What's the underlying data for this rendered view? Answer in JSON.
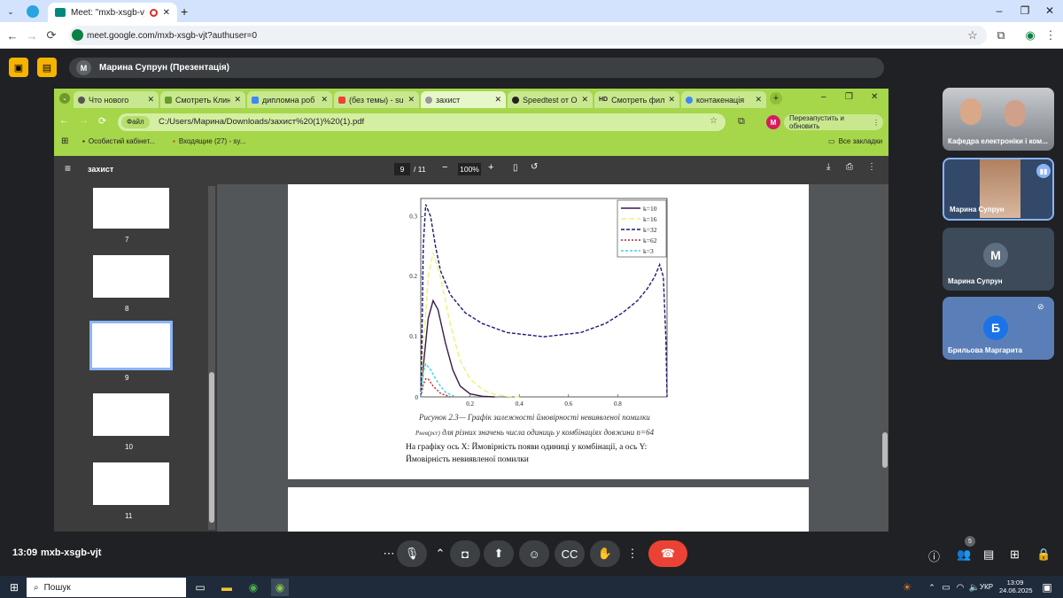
{
  "chrome": {
    "tab_title": "Meet: \"mxb-xsgb-vjt\"",
    "url": "meet.google.com/mxb-xsgb-vjt?authuser=0"
  },
  "meet": {
    "presenter_label": "Марина Супрун (Презентація)",
    "time": "13:09",
    "meeting_code": "mxb-xsgb-vjt",
    "participants_badge": "5",
    "participants": [
      {
        "name": "Кафедра електроніки і ком..."
      },
      {
        "name": "Марина Супрун"
      },
      {
        "name": "Марина Супрун",
        "initial": "М"
      },
      {
        "name": "Брильова Маргарита",
        "initial": "Б"
      }
    ],
    "presenter_avatar": "М"
  },
  "inner": {
    "tabs": [
      {
        "label": "Что нового"
      },
      {
        "label": "Смотреть Клин"
      },
      {
        "label": "дипломна роб"
      },
      {
        "label": "(без темы) - sur"
      },
      {
        "label": "захист"
      },
      {
        "label": "Speedtest от Ос"
      },
      {
        "label": "Смотреть филь"
      },
      {
        "label": "контакенація"
      }
    ],
    "file_chip": "Файл",
    "path": "C:/Users/Марина/Downloads/захист%20(1)%20(1).pdf",
    "relaunch": "Перезапустить и обновить",
    "profile": "М",
    "bookmarks": [
      {
        "label": "Особистий кабінет..."
      },
      {
        "label": "Входящие (27) - sy..."
      }
    ],
    "all_bookmarks": "Все закладки"
  },
  "pdf": {
    "title": "захист",
    "page_current": "9",
    "page_total": "/ 11",
    "zoom": "100%",
    "thumbs": [
      "7",
      "8",
      "9",
      "10",
      "11"
    ],
    "caption_line1": "Рисунок 2.3— Графік залежності ймовірності невиявленої помилки",
    "caption_line2_sym": "Pнев(pcr)",
    "caption_line2": "для різних значень числа одиниць у комбінаціях довжини  n=64",
    "body_line1": "На графіку ось X: Ймовірність появи одиниці у комбінації, а ось Y:",
    "body_line2": "Ймовірність невиявленої помилки"
  },
  "chart_data": {
    "type": "line",
    "xlim": [
      0,
      1
    ],
    "ylim": [
      0,
      0.33
    ],
    "x_ticks": [
      "0.2",
      "0.4",
      "0.6",
      "0.8"
    ],
    "y_ticks": [
      "0.1",
      "0.2",
      "0.3"
    ],
    "origin_label": "0",
    "legend": "top-right",
    "series": [
      {
        "name": "k=10",
        "color": "#3b1a4a",
        "dash": "solid",
        "x": [
          0,
          0.01,
          0.03,
          0.05,
          0.07,
          0.1,
          0.13,
          0.16,
          0.2,
          0.25,
          0.3
        ],
        "y": [
          0,
          0.05,
          0.13,
          0.16,
          0.145,
          0.09,
          0.045,
          0.018,
          0.005,
          0.001,
          0
        ]
      },
      {
        "name": "k=16",
        "color": "#f0f07a",
        "dash": "6,3",
        "x": [
          0,
          0.01,
          0.03,
          0.05,
          0.08,
          0.12,
          0.16,
          0.2,
          0.25,
          0.3,
          0.35,
          0.4
        ],
        "y": [
          0,
          0.08,
          0.2,
          0.24,
          0.2,
          0.12,
          0.06,
          0.03,
          0.012,
          0.004,
          0.001,
          0
        ]
      },
      {
        "name": "k=32",
        "color": "#1a1a7a",
        "dash": "4,2",
        "x": [
          0,
          0.005,
          0.01,
          0.02,
          0.04,
          0.06,
          0.08,
          0.12,
          0.18,
          0.25,
          0.35,
          0.5,
          0.65,
          0.75,
          0.82,
          0.88,
          0.92,
          0.95,
          0.97,
          0.985,
          0.995,
          1
        ],
        "y": [
          0,
          0.1,
          0.25,
          0.32,
          0.3,
          0.25,
          0.21,
          0.17,
          0.14,
          0.122,
          0.107,
          0.1,
          0.107,
          0.122,
          0.14,
          0.16,
          0.18,
          0.2,
          0.22,
          0.2,
          0.1,
          0
        ]
      },
      {
        "name": "k=62",
        "color": "#c02020",
        "dash": "2,2",
        "x": [
          0,
          0.01,
          0.02,
          0.03,
          0.05,
          0.08,
          0.12
        ],
        "y": [
          0,
          0.02,
          0.03,
          0.03,
          0.018,
          0.006,
          0
        ]
      },
      {
        "name": "k=3",
        "color": "#40d0e0",
        "dash": "3,2",
        "x": [
          0,
          0.01,
          0.02,
          0.04,
          0.06,
          0.08,
          0.1,
          0.14
        ],
        "y": [
          0,
          0.04,
          0.055,
          0.045,
          0.03,
          0.018,
          0.008,
          0
        ]
      }
    ]
  },
  "taskbar": {
    "search": "Пошук",
    "lang": "УКР",
    "time": "13:09",
    "date": "24.06.2025"
  }
}
